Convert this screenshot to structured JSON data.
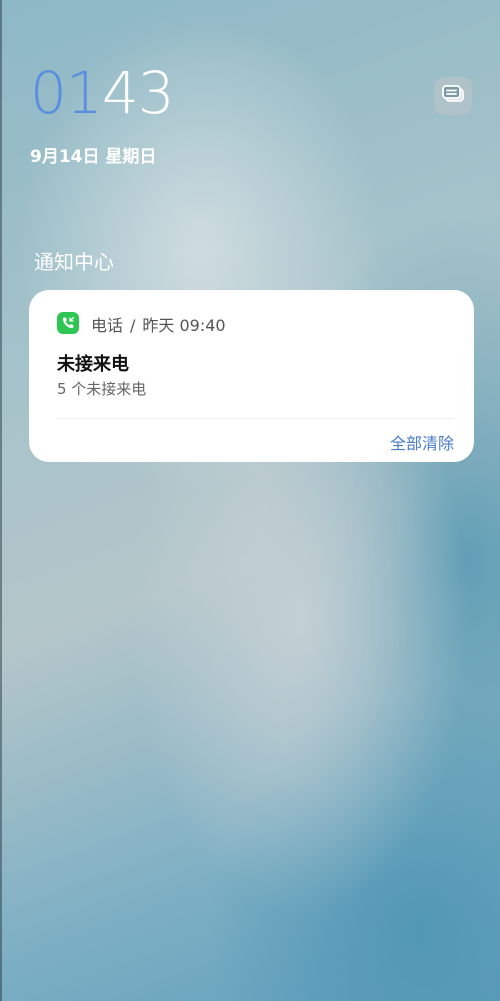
{
  "lockscreen": {
    "time_hours": "01",
    "time_minutes": "43",
    "date": "9月14日 星期日",
    "hours_color": "#5a8fe0"
  },
  "notification_center": {
    "title": "通知中心",
    "notification": {
      "app_icon": "phone-icon",
      "app_name": "电话",
      "separator": "/",
      "time": "昨天 09:40",
      "title": "未接来电",
      "body": "5 个未接来电"
    },
    "clear_all_label": "全部清除",
    "accent_color": "#4a7bc9",
    "app_icon_color": "#2ec653"
  },
  "top_right_button_icon": "multi-window-icon"
}
